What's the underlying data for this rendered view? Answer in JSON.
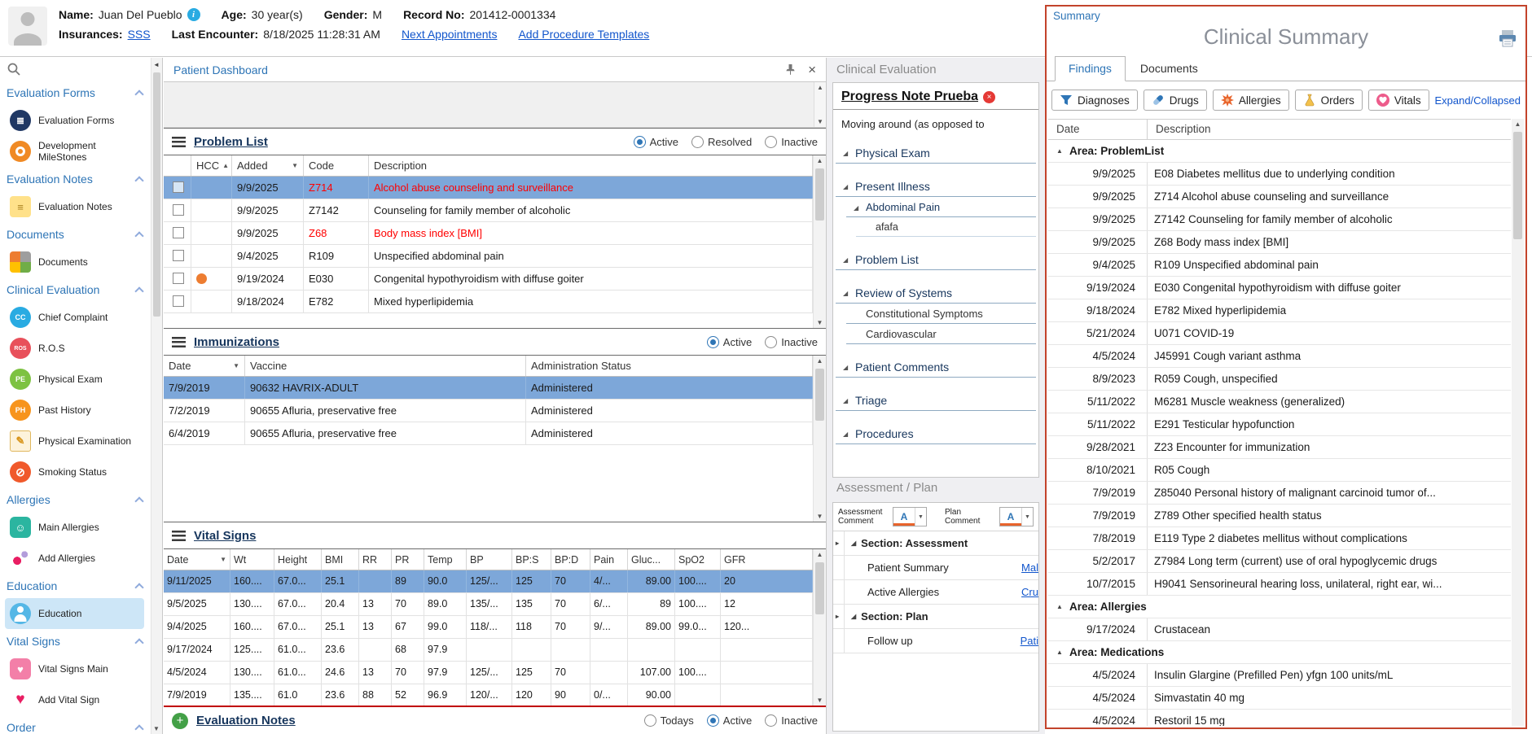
{
  "colors": {
    "accent_blue": "#2E75B6",
    "link_blue": "#1155CC",
    "navy_title": "#17365D",
    "selected_row": "#7DA7D9",
    "alert_red": "#FF0000",
    "summary_border": "#C3432B",
    "title_gray": "#8A8F98"
  },
  "patient_header": {
    "name_label": "Name:",
    "name": "Juan Del Pueblo",
    "age_label": "Age:",
    "age": "30 year(s)",
    "gender_label": "Gender:",
    "gender": "M",
    "record_label": "Record No:",
    "record_no": "201412-0001334",
    "insurances_label": "Insurances:",
    "insurances": "SSS",
    "last_encounter_label": "Last Encounter:",
    "last_encounter": "8/18/2025 11:28:31 AM",
    "next_appointments": "Next Appointments",
    "add_procedure_templates": "Add Procedure Templates"
  },
  "sidebar": {
    "sections": [
      {
        "label": "Evaluation Forms",
        "items": [
          {
            "label": "Evaluation Forms",
            "icon": "evaluation-forms-icon",
            "icon_text": "≣"
          },
          {
            "label": "Development MileStones",
            "icon": "milestones-icon",
            "icon_text": ""
          }
        ]
      },
      {
        "label": "Evaluation Notes",
        "items": [
          {
            "label": "Evaluation Notes",
            "icon": "evaluation-notes-icon",
            "icon_text": "≡"
          }
        ]
      },
      {
        "label": "Documents",
        "items": [
          {
            "label": "Documents",
            "icon": "documents-icon",
            "icon_text": ""
          }
        ]
      },
      {
        "label": "Clinical Evaluation",
        "items": [
          {
            "label": "Chief Complaint",
            "icon": "chief-complaint-icon",
            "icon_text": "CC"
          },
          {
            "label": "R.O.S",
            "icon": "ros-icon",
            "icon_text": "ROS"
          },
          {
            "label": "Physical Exam",
            "icon": "physical-exam-icon",
            "icon_text": "PE"
          },
          {
            "label": "Past History",
            "icon": "past-history-icon",
            "icon_text": "PH"
          },
          {
            "label": "Physical Examination",
            "icon": "physical-examination-icon",
            "icon_text": "✎"
          },
          {
            "label": "Smoking Status",
            "icon": "smoking-status-icon",
            "icon_text": "⊘"
          }
        ]
      },
      {
        "label": "Allergies",
        "items": [
          {
            "label": "Main Allergies",
            "icon": "main-allergies-icon",
            "icon_text": "☺"
          },
          {
            "label": "Add Allergies",
            "icon": "add-allergies-icon",
            "icon_text": ""
          }
        ]
      },
      {
        "label": "Education",
        "items": [
          {
            "label": "Education",
            "icon": "education-icon",
            "icon_text": "",
            "selected": true
          }
        ]
      },
      {
        "label": "Vital Signs",
        "items": [
          {
            "label": "Vital Signs Main",
            "icon": "vital-signs-main-icon",
            "icon_text": "♥"
          },
          {
            "label": "Add Vital Sign",
            "icon": "add-vital-sign-icon",
            "icon_text": "♥"
          }
        ]
      },
      {
        "label": "Order",
        "items": []
      }
    ]
  },
  "dashboard": {
    "tab_label": "Patient Dashboard",
    "problem_list": {
      "title": "Problem List",
      "filters": {
        "options": [
          "Active",
          "Resolved",
          "Inactive"
        ],
        "selected": "Active"
      },
      "columns": [
        "",
        "HCC",
        "Added",
        "Code",
        "Description"
      ],
      "rows": [
        {
          "added": "9/9/2025",
          "code": "Z714",
          "description": "Alcohol abuse counseling and surveillance",
          "red": true,
          "selected": true
        },
        {
          "added": "9/9/2025",
          "code": "Z7142",
          "description": "Counseling for family member of alcoholic"
        },
        {
          "added": "9/9/2025",
          "code": "Z68",
          "description": "Body mass index [BMI]",
          "red": true
        },
        {
          "added": "9/4/2025",
          "code": "R109",
          "description": "Unspecified abdominal pain"
        },
        {
          "added": "9/19/2024",
          "code": "E030",
          "description": "Congenital hypothyroidism with diffuse goiter",
          "hcc_dot": true
        },
        {
          "added": "9/18/2024",
          "code": "E782",
          "description": "Mixed hyperlipidemia"
        }
      ]
    },
    "immunizations": {
      "title": "Immunizations",
      "filters": {
        "options": [
          "Active",
          "Inactive"
        ],
        "selected": "Active"
      },
      "columns": [
        "Date",
        "Vaccine",
        "Administration Status"
      ],
      "rows": [
        {
          "date": "7/9/2019",
          "vaccine": "90632 HAVRIX-ADULT",
          "status": "Administered",
          "selected": true
        },
        {
          "date": "7/2/2019",
          "vaccine": "90655 Afluria, preservative free",
          "status": "Administered"
        },
        {
          "date": "6/4/2019",
          "vaccine": "90655 Afluria, preservative free",
          "status": "Administered"
        }
      ]
    },
    "vital_signs": {
      "title": "Vital Signs",
      "columns": [
        "Date",
        "Wt",
        "Height",
        "BMI",
        "RR",
        "PR",
        "Temp",
        "BP",
        "BP:S",
        "BP:D",
        "Pain",
        "Gluc...",
        "SpO2",
        "GFR"
      ],
      "rows": [
        {
          "cells": [
            "9/11/2025",
            "160....",
            "67.0...",
            "25.1",
            "",
            "89",
            "90.0",
            "125/...",
            "125",
            "70",
            "4/...",
            "89.00",
            "100....",
            "20"
          ],
          "selected": true
        },
        {
          "cells": [
            "9/5/2025",
            "130....",
            "67.0...",
            "20.4",
            "13",
            "70",
            "89.0",
            "135/...",
            "135",
            "70",
            "6/...",
            "89",
            "100....",
            "12"
          ]
        },
        {
          "cells": [
            "9/4/2025",
            "160....",
            "67.0...",
            "25.1",
            "13",
            "67",
            "99.0",
            "118/...",
            "118",
            "70",
            "9/...",
            "89.00",
            "99.0...",
            "120..."
          ]
        },
        {
          "cells": [
            "9/17/2024",
            "125....",
            "61.0...",
            "23.6",
            "",
            "68",
            "97.9",
            "",
            "",
            "",
            "",
            "",
            "",
            ""
          ]
        },
        {
          "cells": [
            "4/5/2024",
            "130....",
            "61.0...",
            "24.6",
            "13",
            "70",
            "97.9",
            "125/...",
            "125",
            "70",
            "",
            "107.00",
            "100....",
            ""
          ]
        },
        {
          "cells": [
            "7/9/2019",
            "135....",
            "61.0",
            "23.6",
            "88",
            "52",
            "96.9",
            "120/...",
            "120",
            "90",
            "0/...",
            "90.00",
            "",
            ""
          ]
        }
      ]
    },
    "evaluation_notes_bar": {
      "title": "Evaluation Notes",
      "filters": {
        "options": [
          "Todays",
          "Active",
          "Inactive"
        ],
        "selected": "Active"
      }
    }
  },
  "clinical_evaluation": {
    "panel_title": "Clinical Evaluation",
    "note_title": "Progress Note Prueba",
    "note_preview": "Moving around (as opposed to",
    "outline": [
      {
        "label": "Physical Exam",
        "level": 0
      },
      {
        "label": "Present Illness",
        "level": 0
      },
      {
        "label": "Abdominal Pain",
        "level": 1
      },
      {
        "label": "afafa",
        "level": 2,
        "plain": true
      },
      {
        "label": "Problem List",
        "level": 0
      },
      {
        "label": "Review of Systems",
        "level": 0
      },
      {
        "label": "Constitutional Symptoms",
        "level": 1,
        "plain": true
      },
      {
        "label": "Cardiovascular",
        "level": 1,
        "plain": true
      },
      {
        "label": "Patient Comments",
        "level": 0
      },
      {
        "label": "Triage",
        "level": 0
      },
      {
        "label": "Procedures",
        "level": 0
      }
    ]
  },
  "assessment_plan": {
    "panel_title": "Assessment / Plan",
    "assessment_comment_label": "Assessment Comment",
    "plan_comment_label": "Plan Comment",
    "rows": [
      {
        "type": "section",
        "label": "Section: Assessment"
      },
      {
        "type": "item",
        "label": "Patient Summary",
        "link": "Mal"
      },
      {
        "type": "item",
        "label": "Active Allergies",
        "link": "Cru"
      },
      {
        "type": "section",
        "label": "Section: Plan"
      },
      {
        "type": "item",
        "label": "Follow up",
        "link": "Pati"
      }
    ]
  },
  "summary": {
    "header": "Summary",
    "title": "Clinical Summary",
    "tabs": [
      "Findings",
      "Documents"
    ],
    "active_tab": "Findings",
    "filters": [
      {
        "label": "Diagnoses",
        "icon": "diagnoses-icon"
      },
      {
        "label": "Drugs",
        "icon": "drugs-icon"
      },
      {
        "label": "Allergies",
        "icon": "allergies-icon"
      },
      {
        "label": "Orders",
        "icon": "orders-icon"
      },
      {
        "label": "Vitals",
        "icon": "vitals-icon"
      }
    ],
    "expand_link": "Expand/Collapsed",
    "columns": [
      "Date",
      "Description"
    ],
    "rows": [
      {
        "group": "Area: ProblemList"
      },
      {
        "date": "9/9/2025",
        "description": "E08 Diabetes mellitus due to underlying condition"
      },
      {
        "date": "9/9/2025",
        "description": "Z714 Alcohol abuse counseling and surveillance"
      },
      {
        "date": "9/9/2025",
        "description": "Z7142 Counseling for family member of alcoholic"
      },
      {
        "date": "9/9/2025",
        "description": "Z68 Body mass index [BMI]"
      },
      {
        "date": "9/4/2025",
        "description": "R109 Unspecified abdominal pain"
      },
      {
        "date": "9/19/2024",
        "description": "E030 Congenital hypothyroidism with diffuse goiter"
      },
      {
        "date": "9/18/2024",
        "description": "E782 Mixed hyperlipidemia"
      },
      {
        "date": "5/21/2024",
        "description": "U071 COVID-19"
      },
      {
        "date": "4/5/2024",
        "description": "J45991 Cough variant asthma"
      },
      {
        "date": "8/9/2023",
        "description": "R059 Cough, unspecified"
      },
      {
        "date": "5/11/2022",
        "description": "M6281 Muscle weakness (generalized)"
      },
      {
        "date": "5/11/2022",
        "description": "E291 Testicular hypofunction"
      },
      {
        "date": "9/28/2021",
        "description": "Z23 Encounter for immunization"
      },
      {
        "date": "8/10/2021",
        "description": "R05 Cough"
      },
      {
        "date": "7/9/2019",
        "description": "Z85040 Personal history of malignant carcinoid tumor of..."
      },
      {
        "date": "7/9/2019",
        "description": "Z789 Other specified health status"
      },
      {
        "date": "7/8/2019",
        "description": "E119 Type 2 diabetes mellitus without complications"
      },
      {
        "date": "5/2/2017",
        "description": "Z7984 Long term (current) use of oral hypoglycemic drugs"
      },
      {
        "date": "10/7/2015",
        "description": "H9041 Sensorineural hearing loss, unilateral, right ear, wi..."
      },
      {
        "group": "Area: Allergies"
      },
      {
        "date": "9/17/2024",
        "description": "Crustacean"
      },
      {
        "group": "Area: Medications"
      },
      {
        "date": "4/5/2024",
        "description": "Insulin Glargine (Prefilled Pen) yfgn 100 units/mL"
      },
      {
        "date": "4/5/2024",
        "description": "Simvastatin 40 mg"
      },
      {
        "date": "4/5/2024",
        "description": "Restoril 15 mg"
      }
    ]
  }
}
